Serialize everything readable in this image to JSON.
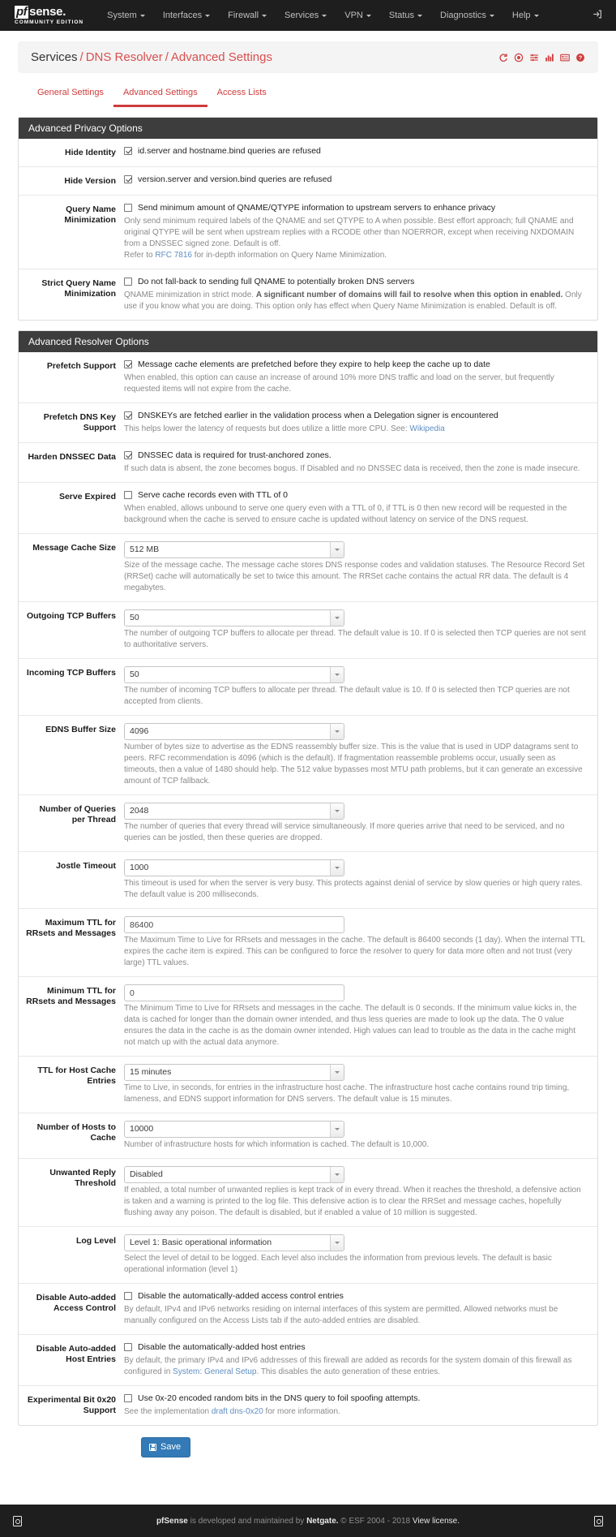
{
  "navbar": {
    "brand_pf": "pf",
    "brand_sense": "sense.",
    "brand_sub": "COMMUNITY EDITION",
    "items": [
      {
        "label": "System"
      },
      {
        "label": "Interfaces"
      },
      {
        "label": "Firewall"
      },
      {
        "label": "Services"
      },
      {
        "label": "VPN"
      },
      {
        "label": "Status"
      },
      {
        "label": "Diagnostics"
      },
      {
        "label": "Help"
      }
    ],
    "logout_icon": "logout-icon"
  },
  "breadcrumb": {
    "root": "Services",
    "sep": "/",
    "level2": "DNS Resolver",
    "level3": "Advanced Settings",
    "icons": [
      "restart-service-icon",
      "stop-service-icon",
      "related-settings-icon",
      "status-chart-icon",
      "log-entries-icon",
      "help-icon"
    ]
  },
  "tabs": [
    {
      "label": "General Settings",
      "active": false
    },
    {
      "label": "Advanced Settings",
      "active": true
    },
    {
      "label": "Access Lists",
      "active": false
    }
  ],
  "privacy": {
    "heading": "Advanced Privacy Options",
    "rows": [
      {
        "label": "Hide Identity",
        "checked": true,
        "check_text": "id.server and hostname.bind queries are refused",
        "help": ""
      },
      {
        "label": "Hide Version",
        "checked": true,
        "check_text": "version.server and version.bind queries are refused",
        "help": ""
      },
      {
        "label": "Query Name Minimization",
        "checked": false,
        "check_text": "Send minimum amount of QNAME/QTYPE information to upstream servers to enhance privacy",
        "help": "Only send minimum required labels of the QNAME and set QTYPE to A when possible. Best effort approach; full QNAME and original QTYPE will be sent when upstream replies with a RCODE other than NOERROR, except when receiving NXDOMAIN from a DNSSEC signed zone. Default is off.",
        "help_line2_prefix": "Refer to ",
        "help_link": "RFC 7816",
        "help_line2_suffix": " for in-depth information on Query Name Minimization."
      },
      {
        "label": "Strict Query Name Minimization",
        "checked": false,
        "check_text": "Do not fall-back to sending full QNAME to potentially broken DNS servers",
        "help_prefix": "QNAME minimization in strict mode. ",
        "help_bold": "A significant number of domains will fail to resolve when this option in enabled.",
        "help_suffix": " Only use if you know what you are doing. This option only has effect when Query Name Minimization is enabled. Default is off."
      }
    ]
  },
  "resolver": {
    "heading": "Advanced Resolver Options",
    "rows": [
      {
        "type": "checkbox",
        "label": "Prefetch Support",
        "checked": true,
        "check_text": "Message cache elements are prefetched before they expire to help keep the cache up to date",
        "help": "When enabled, this option can cause an increase of around 10% more DNS traffic and load on the server, but frequently requested items will not expire from the cache."
      },
      {
        "type": "checkbox",
        "label": "Prefetch DNS Key Support",
        "checked": true,
        "check_text": "DNSKEYs are fetched earlier in the validation process when a Delegation signer is encountered",
        "help_prefix": "This helps lower the latency of requests but does utilize a little more CPU. See: ",
        "help_link": "Wikipedia"
      },
      {
        "type": "checkbox",
        "label": "Harden DNSSEC Data",
        "checked": true,
        "check_text": "DNSSEC data is required for trust-anchored zones.",
        "help": "If such data is absent, the zone becomes bogus. If Disabled and no DNSSEC data is received, then the zone is made insecure."
      },
      {
        "type": "checkbox",
        "label": "Serve Expired",
        "checked": false,
        "check_text": "Serve cache records even with TTL of 0",
        "help": "When enabled, allows unbound to serve one query even with a TTL of 0, if TTL is 0 then new record will be requested in the background when the cache is served to ensure cache is updated without latency on service of the DNS request."
      },
      {
        "type": "select",
        "label": "Message Cache Size",
        "value": "512 MB",
        "help": "Size of the message cache. The message cache stores DNS response codes and validation statuses. The Resource Record Set (RRSet) cache will automatically be set to twice this amount. The RRSet cache contains the actual RR data. The default is 4 megabytes."
      },
      {
        "type": "select",
        "label": "Outgoing TCP Buffers",
        "value": "50",
        "help": "The number of outgoing TCP buffers to allocate per thread. The default value is 10. If 0 is selected then TCP queries are not sent to authoritative servers."
      },
      {
        "type": "select",
        "label": "Incoming TCP Buffers",
        "value": "50",
        "help": "The number of incoming TCP buffers to allocate per thread. The default value is 10. If 0 is selected then TCP queries are not accepted from clients."
      },
      {
        "type": "select",
        "label": "EDNS Buffer Size",
        "value": "4096",
        "help": "Number of bytes size to advertise as the EDNS reassembly buffer size. This is the value that is used in UDP datagrams sent to peers. RFC recommendation is 4096 (which is the default). If fragmentation reassemble problems occur, usually seen as timeouts, then a value of 1480 should help. The 512 value bypasses most MTU path problems, but it can generate an excessive amount of TCP fallback."
      },
      {
        "type": "select",
        "label": "Number of Queries per Thread",
        "value": "2048",
        "help": "The number of queries that every thread will service simultaneously. If more queries arrive that need to be serviced, and no queries can be jostled, then these queries are dropped."
      },
      {
        "type": "select",
        "label": "Jostle Timeout",
        "value": "1000",
        "help": "This timeout is used for when the server is very busy. This protects against denial of service by slow queries or high query rates. The default value is 200 milliseconds."
      },
      {
        "type": "text",
        "label": "Maximum TTL for RRsets and Messages",
        "value": "86400",
        "help": "The Maximum Time to Live for RRsets and messages in the cache. The default is 86400 seconds (1 day). When the internal TTL expires the cache item is expired. This can be configured to force the resolver to query for data more often and not trust (very large) TTL values."
      },
      {
        "type": "text",
        "label": "Minimum TTL for RRsets and Messages",
        "value": "0",
        "help": "The Minimum Time to Live for RRsets and messages in the cache. The default is 0 seconds. If the minimum value kicks in, the data is cached for longer than the domain owner intended, and thus less queries are made to look up the data. The 0 value ensures the data in the cache is as the domain owner intended. High values can lead to trouble as the data in the cache might not match up with the actual data anymore."
      },
      {
        "type": "select",
        "label": "TTL for Host Cache Entries",
        "value": "15 minutes",
        "help": "Time to Live, in seconds, for entries in the infrastructure host cache. The infrastructure host cache contains round trip timing, lameness, and EDNS support information for DNS servers. The default value is 15 minutes."
      },
      {
        "type": "select",
        "label": "Number of Hosts to Cache",
        "value": "10000",
        "help": "Number of infrastructure hosts for which information is cached. The default is 10,000."
      },
      {
        "type": "select",
        "label": "Unwanted Reply Threshold",
        "value": "Disabled",
        "help": "If enabled, a total number of unwanted replies is kept track of in every thread. When it reaches the threshold, a defensive action is taken and a warning is printed to the log file. This defensive action is to clear the RRSet and message caches, hopefully flushing away any poison. The default is disabled, but if enabled a value of 10 million is suggested."
      },
      {
        "type": "select",
        "label": "Log Level",
        "value": "Level 1: Basic operational information",
        "help": "Select the level of detail to be logged. Each level also includes the information from previous levels. The default is basic operational information (level 1)"
      },
      {
        "type": "checkbox",
        "label": "Disable Auto-added Access Control",
        "checked": false,
        "check_text": "Disable the automatically-added access control entries",
        "help": "By default, IPv4 and IPv6 networks residing on internal interfaces of this system are permitted. Allowed networks must be manually configured on the Access Lists tab if the auto-added entries are disabled."
      },
      {
        "type": "checkbox",
        "label": "Disable Auto-added Host Entries",
        "checked": false,
        "check_text": "Disable the automatically-added host entries",
        "help_prefix": "By default, the primary IPv4 and IPv6 addresses of this firewall are added as records for the system domain of this firewall as configured in ",
        "help_link": "System: General Setup",
        "help_suffix": ". This disables the auto generation of these entries."
      },
      {
        "type": "checkbox",
        "label": "Experimental Bit 0x20 Support",
        "checked": false,
        "check_text": "Use 0x-20 encoded random bits in the DNS query to foil spoofing attempts.",
        "help_prefix": "See the implementation ",
        "help_link": "draft dns-0x20",
        "help_suffix": " for more information."
      }
    ]
  },
  "save": {
    "label": "Save",
    "icon": "floppy-save-icon"
  },
  "footer": {
    "left_icon": "dock-left-icon",
    "right_icon": "dock-right-icon",
    "brand": "pfSense",
    "text1": " is developed and maintained by ",
    "netgate": "Netgate.",
    "text2": " © ESF 2004 - 2018 ",
    "license": "View license."
  },
  "colors": {
    "brand_red": "#cf3c3c",
    "navbar_bg": "#1e1e1e",
    "panel_heading_bg": "#3d3d3d",
    "save_blue": "#337ab7",
    "link_blue": "#5f8ec4"
  }
}
